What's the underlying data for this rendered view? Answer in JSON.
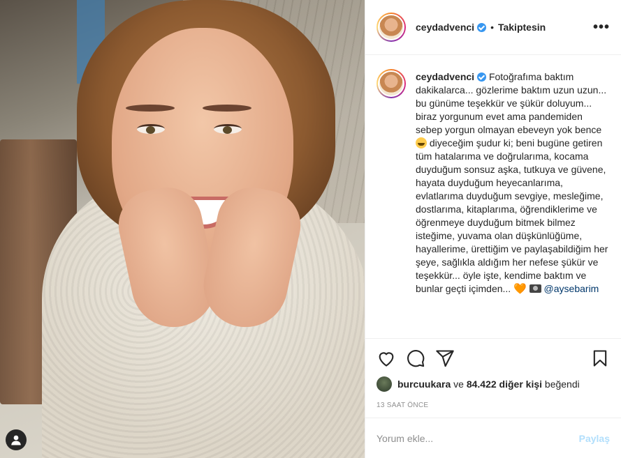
{
  "post": {
    "username": "ceydadvenci",
    "separator": "•",
    "follow_status": "Takiptesin",
    "more_label": "•••"
  },
  "caption": {
    "username": "ceydadvenci",
    "text_part1": " Fotoğrafıma baktım dakikalarca... gözlerime baktım uzun uzun... bu günüme teşekkür ve şükür doluyum... biraz yorgunum evet ama pandemiden sebep yorgun olmayan ebeveyn yok bence ",
    "text_part2": " diyeceğim şudur ki; beni bugüne getiren tüm hatalarıma ve doğrularıma, kocama duyduğum sonsuz aşka, tutkuya ve güvene, hayata duyduğum heyecanlarıma, evlatlarıma duyduğum sevgiye, mesleğime, dostlarıma, kitaplarıma, öğrendiklerime ve öğrenmeye duyduğum bitmek bilmez isteğime, yuvama olan düşkünlüğüme, hayallerime, ürettiğim ve paylaşabildiğim her şeye, sağlıkla aldığım her nefese şükür ve teşekkür... öyle işte, kendime baktım ve bunlar geçti içimden... ",
    "heart": "🧡",
    "mention": "@aysebarim"
  },
  "likes": {
    "liker": "burcuukara",
    "connector": "ve",
    "count_text": "84.422 diğer kişi",
    "suffix": "beğendi"
  },
  "timestamp": "13 SAAT ÖNCE",
  "comment": {
    "placeholder": "Yorum ekle...",
    "post_label": "Paylaş"
  },
  "icons": [
    "like-heart-icon",
    "comment-icon",
    "share-icon",
    "save-bookmark-icon",
    "user-tag-icon",
    "verified-icon",
    "more-icon"
  ],
  "colors": {
    "verified": "#3897f0",
    "post_disabled": "#b2dffc",
    "muted": "#8e8e8e",
    "mention": "#00376b"
  }
}
